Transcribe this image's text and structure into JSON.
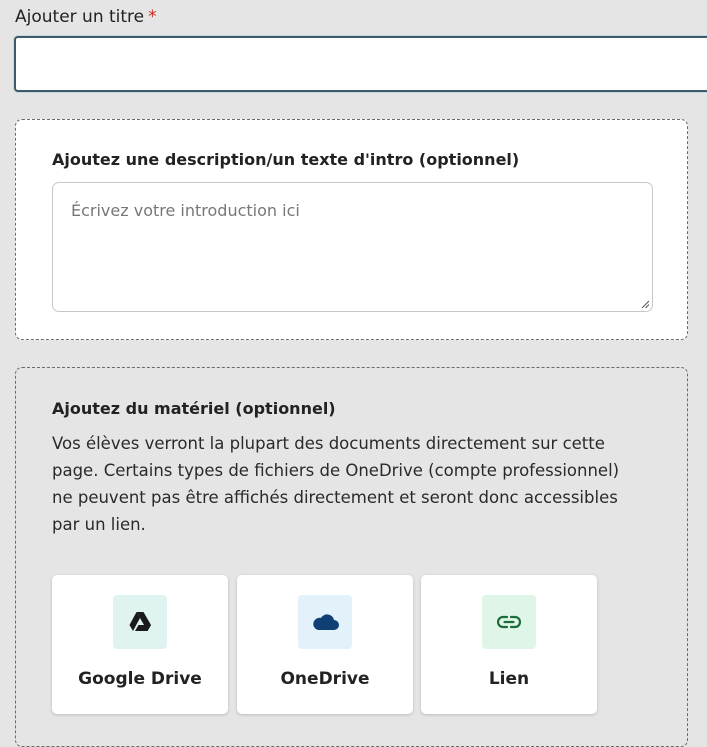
{
  "title_field": {
    "label": "Ajouter un titre",
    "required_mark": "*",
    "value": ""
  },
  "description": {
    "heading": "Ajoutez une description/un texte d'intro (optionnel)",
    "placeholder": "Écrivez votre introduction ici"
  },
  "material": {
    "heading": "Ajoutez du matériel (optionnel)",
    "text": "Vos élèves verront la plupart des documents directement sur cette page. Certains types de fichiers de OneDrive (compte professionnel) ne peuvent pas être affichés directement et seront donc accessibles par un lien.",
    "options": [
      {
        "label": "Google Drive",
        "icon": "google-drive-icon",
        "bg": "#dff3f1",
        "color": "#1a1a1a"
      },
      {
        "label": "OneDrive",
        "icon": "onedrive-icon",
        "bg": "#e3f1fb",
        "color": "#0f3f73"
      },
      {
        "label": "Lien",
        "icon": "link-icon",
        "bg": "#dff5e8",
        "color": "#1b6e3a"
      }
    ]
  },
  "colors": {
    "required": "#d0271d",
    "input_border": "#3c5a6a"
  }
}
